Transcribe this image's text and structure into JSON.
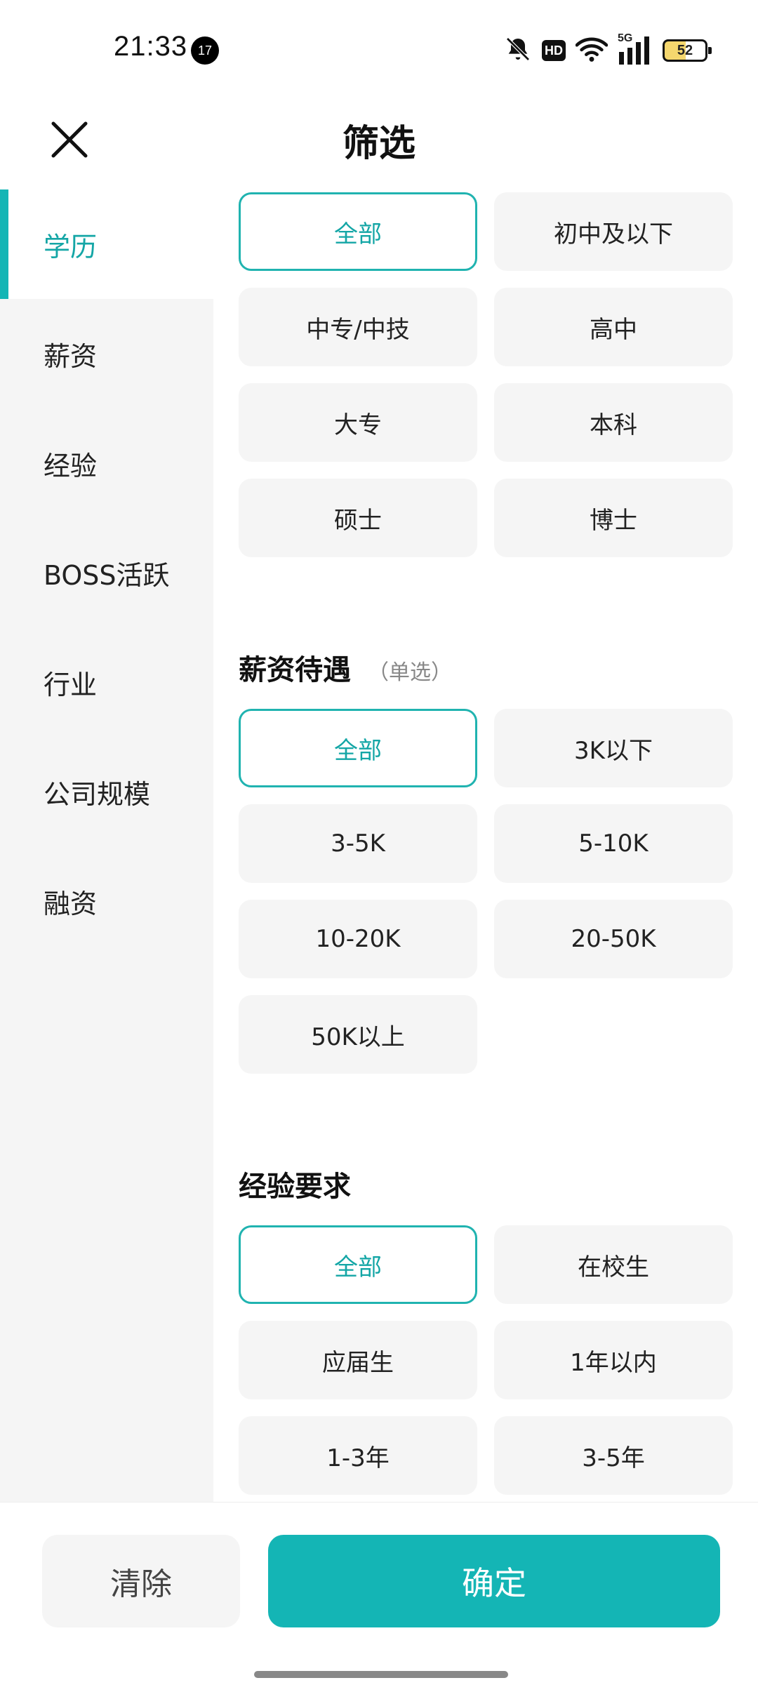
{
  "status_bar": {
    "time": "21:33",
    "notification_count": "17",
    "network": "5G",
    "hd_label": "HD",
    "battery": "52"
  },
  "header": {
    "title": "筛选"
  },
  "sidebar": {
    "items": [
      {
        "label": "学历",
        "active": true
      },
      {
        "label": "薪资",
        "active": false
      },
      {
        "label": "经验",
        "active": false
      },
      {
        "label": "BOSS活跃",
        "active": false
      },
      {
        "label": "行业",
        "active": false
      },
      {
        "label": "公司规模",
        "active": false
      },
      {
        "label": "融资",
        "active": false
      }
    ]
  },
  "education": {
    "options": [
      "全部",
      "初中及以下",
      "中专/中技",
      "高中",
      "大专",
      "本科",
      "硕士",
      "博士"
    ],
    "selected": "全部"
  },
  "salary": {
    "title": "薪资待遇",
    "note": "（单选）",
    "options": [
      "全部",
      "3K以下",
      "3-5K",
      "5-10K",
      "10-20K",
      "20-50K",
      "50K以上"
    ],
    "selected": "全部"
  },
  "experience": {
    "title": "经验要求",
    "options": [
      "全部",
      "在校生",
      "应届生",
      "1年以内",
      "1-3年",
      "3-5年"
    ],
    "selected": "全部"
  },
  "actions": {
    "clear_label": "清除",
    "confirm_label": "确定"
  },
  "colors": {
    "accent": "#14b5b5",
    "selected_border": "#20b3b0",
    "chip_bg": "#f5f5f5"
  }
}
